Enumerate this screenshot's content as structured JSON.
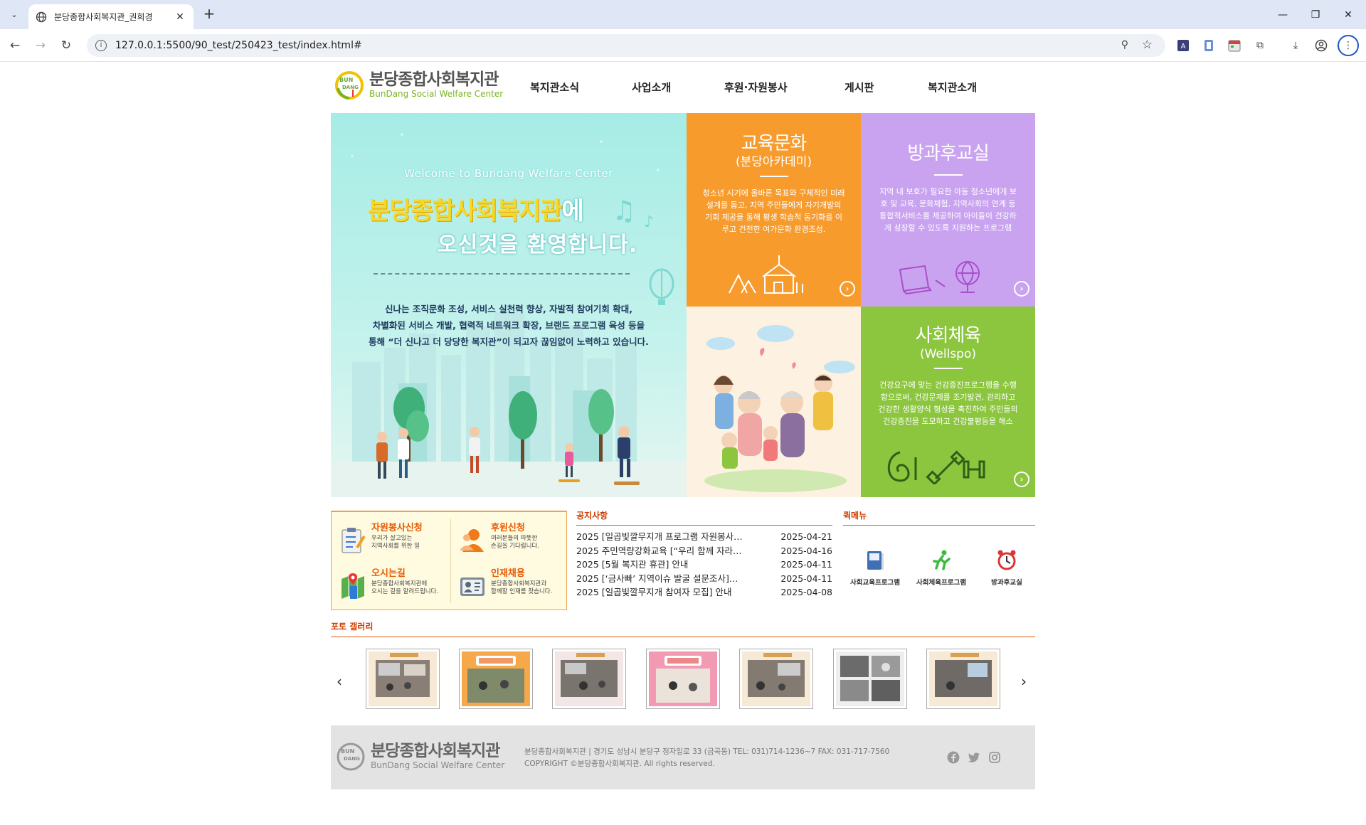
{
  "browser": {
    "tab_title": "분당종합사회복지관_권희경",
    "url": "127.0.0.1:5500/90_test/250423_test/index.html#"
  },
  "site": {
    "logo": {
      "kr": "분당종합사회복지관",
      "en": "BunDang Social Welfare Center"
    },
    "nav": [
      "복지관소식",
      "사업소개",
      "후원·자원봉사",
      "게시판",
      "복지관소개"
    ],
    "hero": {
      "welcome_en": "Welcome to Bundang Welfare Center",
      "welcome_kr1": "분당종합사회복지관",
      "welcome_kr1_suffix": "에",
      "welcome_kr2": "오신것을 환영합니다.",
      "desc": [
        "신나는 조직문화 조성, 서비스 실천력 향상, 자발적 참여기회 확대,",
        "차별화된 서비스 개발, 협력적 네트워크 확장, 브랜드 프로그램 육성 등을",
        "통해 “더 신나고 더 당당한 복지관”이 되고자 끊임없이 노력하고 있습니다."
      ]
    },
    "tiles": [
      {
        "title": "교육문화",
        "sub": "(분당아카데미)",
        "desc": "청소년 시기에 올바른 목표와 구체적인 미래설계를 돕고, 지역 주민들에게 자기개발의 기회 제공을 통해 평생 학습적 동기화를 이루고 건전한 여가문화 환경조성.",
        "color": "#f79b2c"
      },
      {
        "title": "방과후교실",
        "sub": "",
        "desc": "지역 내 보호가 필요한 아동 청소년에게 보호 및 교육, 문화체험, 지역사회의 연계 등 통합적서비스를 제공하여 아이들이 건강하게 성장할 수 있도록 지원하는 프로그램",
        "color": "#c9a3f0"
      },
      {
        "title": "사회체육",
        "sub": "(Wellspo)",
        "desc": "건강요구에 맞는 건강증진프로그램을 수행함으로써, 건강문제를 조기발견, 관리하고 건강한 생활양식 형성을 촉진하여 주민들의 건강증진을 도모하고 건강불평등을 해소",
        "color": "#8cc63f"
      }
    ],
    "quick_box": [
      {
        "title": "자원봉사신청",
        "desc1": "우리가 살고있는",
        "desc2": "지역사회를 위한 일"
      },
      {
        "title": "후원신청",
        "desc1": "여러분들의 따뜻한",
        "desc2": "손길을 기다립니다."
      },
      {
        "title": "오시는길",
        "desc1": "분당종합사회복지관에",
        "desc2": "오시는 길을 알려드립니다."
      },
      {
        "title": "인재채용",
        "desc1": "분당종합사회복지관과",
        "desc2": "함께할 인재를 찾습니다."
      }
    ],
    "notice": {
      "title": "공지사항",
      "items": [
        {
          "text": "2025 [일곱빛깔무지개 프로그램 자원봉사…",
          "date": "2025-04-21"
        },
        {
          "text": "2025 주민역량강화교육 [“우리 함께 자라…",
          "date": "2025-04-16"
        },
        {
          "text": "2025 [5월 복지관 휴관] 안내",
          "date": "2025-04-11"
        },
        {
          "text": "2025 [‘금사빠’ 지역이슈 발굴 설문조사]…",
          "date": "2025-04-11"
        },
        {
          "text": "2025 [일곱빛깔무지개 참여자 모집] 안내",
          "date": "2025-04-08"
        }
      ]
    },
    "quick_menu": {
      "title": "퀵메뉴",
      "items": [
        "사회교육프로그램",
        "사회체육프로그램",
        "방과후교실"
      ]
    },
    "gallery": {
      "title": "포토 갤러리",
      "prev": "‹",
      "next": "›"
    },
    "footer": {
      "info1": "분당종합사회복지관 | 경기도 성남시 분당구 정자일로 33 (금곡동) TEL: 031)714-1236~7 FAX: 031-717-7560",
      "info2": "COPYRIGHT ©분당종합사회복지관. All rights reserved."
    }
  }
}
